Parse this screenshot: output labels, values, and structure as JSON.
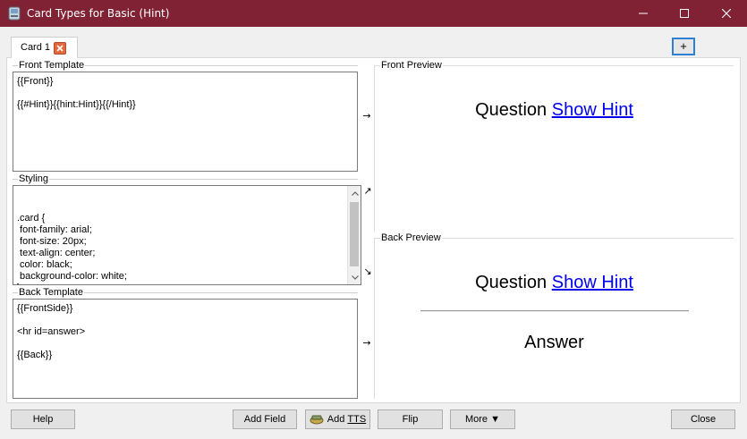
{
  "window": {
    "title": "Card Types for Basic (Hint)"
  },
  "tabs": [
    {
      "label": "Card 1"
    }
  ],
  "add_tab_label": "+",
  "front_template": {
    "label": "Front Template",
    "content": "{{Front}}\n\n{{#Hint}}{{hint:Hint}}{{/Hint}}"
  },
  "styling": {
    "label": "Styling",
    "content": ".card {\n font-family: arial;\n font-size: 20px;\n text-align: center;\n color: black;\n background-color: white;\n}"
  },
  "back_template": {
    "label": "Back Template",
    "content": "{{FrontSide}}\n\n<hr id=answer>\n\n{{Back}}"
  },
  "arrows": {
    "front": "→",
    "styling_up": "↗",
    "styling_down": "↘",
    "back": "→"
  },
  "front_preview": {
    "label": "Front Preview",
    "question": "Question",
    "hint_link": "Show Hint"
  },
  "back_preview": {
    "label": "Back Preview",
    "question": "Question",
    "hint_link": "Show Hint",
    "answer": "Answer"
  },
  "buttons": {
    "help": "Help",
    "add_field": "Add Field",
    "add_tts_prefix": "Add ",
    "add_tts_suffix": "TTS",
    "flip": "Flip",
    "more": "More ▼",
    "close": "Close"
  },
  "colors": {
    "titlebar": "#802234",
    "link": "#0000ee",
    "tab_close": "#e0693f",
    "focus_border": "#2f7fd4"
  },
  "icons": {
    "app": "anki-icon",
    "tab_close": "close-icon",
    "tts": "speaker-icon"
  }
}
